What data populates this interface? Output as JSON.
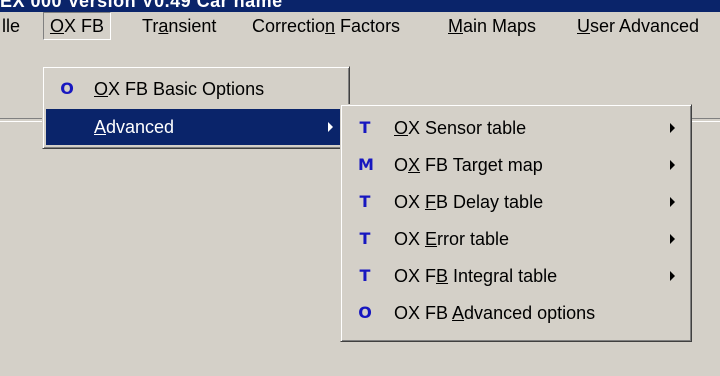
{
  "title": {
    "text": "EX 000  Version  V0.49  Car name"
  },
  "menubar": {
    "items": [
      {
        "pre": "",
        "ul": "",
        "post": "lle"
      },
      {
        "pre": "",
        "ul": "O",
        "post": "X FB"
      },
      {
        "pre": "Tr",
        "ul": "a",
        "post": "nsient"
      },
      {
        "pre": "Correctio",
        "ul": "n",
        "post": " Factors"
      },
      {
        "pre": "",
        "ul": "M",
        "post": "ain Maps"
      },
      {
        "pre": "",
        "ul": "U",
        "post": "ser Advanced"
      }
    ]
  },
  "ox_menu": {
    "items": [
      {
        "badge": "O",
        "pre": "",
        "ul": "O",
        "post": "X FB Basic Options"
      },
      {
        "badge": "",
        "pre": "",
        "ul": "A",
        "post": "dvanced",
        "submenu": true
      }
    ]
  },
  "advanced_menu": {
    "items": [
      {
        "badge": "T",
        "pre": "",
        "ul": "O",
        "post": "X Sensor table",
        "submenu": true
      },
      {
        "badge": "M",
        "pre": "O",
        "ul": "X",
        "post": " FB Target map",
        "submenu": true
      },
      {
        "badge": "T",
        "pre": "OX ",
        "ul": "F",
        "post": "B Delay table",
        "submenu": true
      },
      {
        "badge": "T",
        "pre": "OX ",
        "ul": "E",
        "post": "rror table",
        "submenu": true
      },
      {
        "badge": "T",
        "pre": "OX F",
        "ul": "B",
        "post": " Integral table",
        "submenu": true
      },
      {
        "badge": "O",
        "pre": "OX FB ",
        "ul": "A",
        "post": "dvanced options"
      }
    ]
  },
  "colors": {
    "face": "#d4d0c8",
    "highlight": "#0a246a",
    "badge": "#1717c0"
  }
}
